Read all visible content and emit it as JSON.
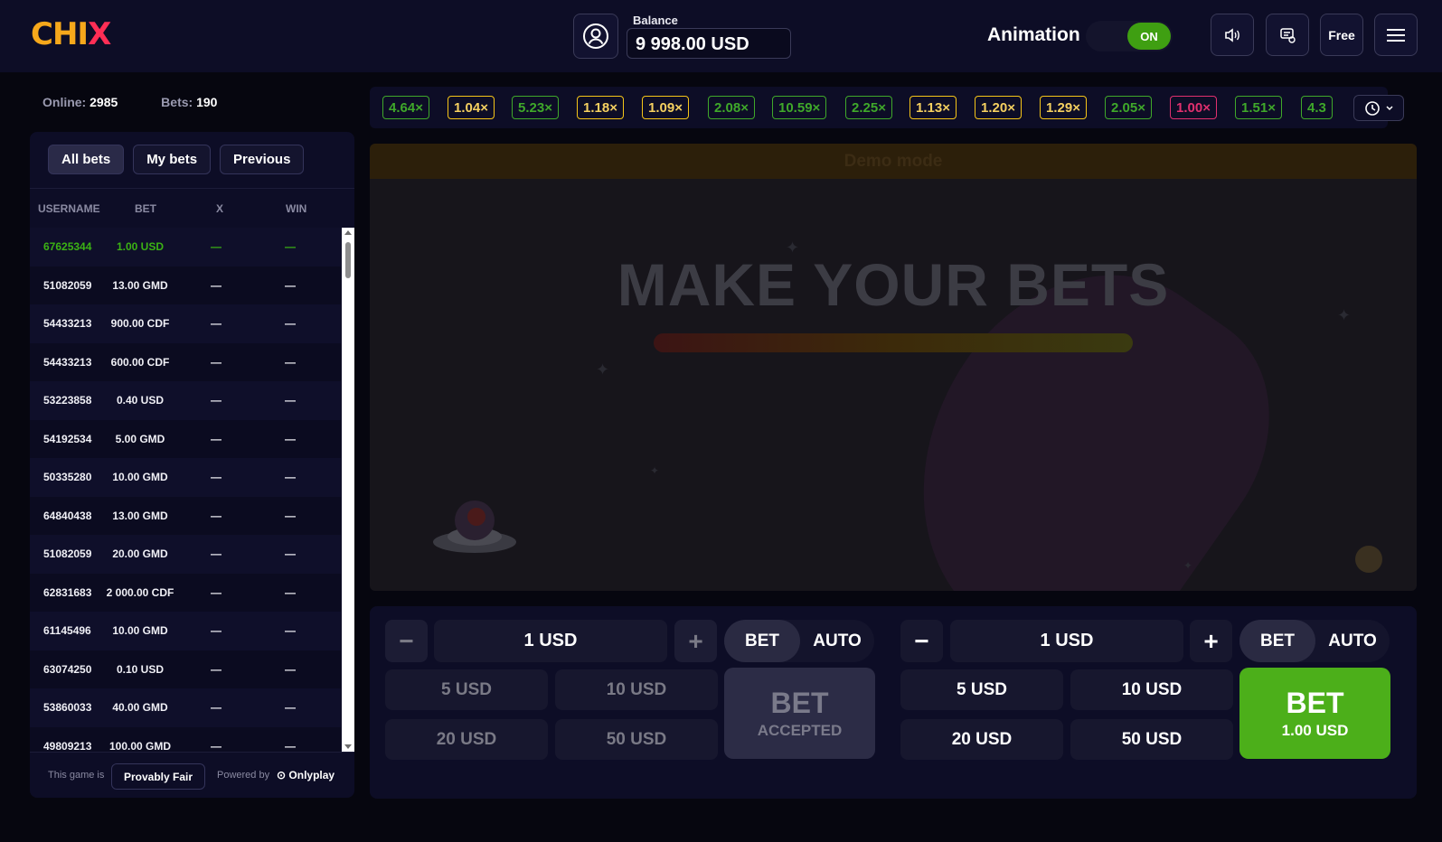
{
  "header": {
    "logo_c": "C",
    "logo_hi": "HI",
    "logo_x": "X",
    "balance_label": "Balance",
    "balance_value": "9 998.00 USD",
    "animation_label": "Animation",
    "animation_state": "ON",
    "free_label": "Free"
  },
  "stats": {
    "online_label": "Online:",
    "online_value": "2985",
    "bets_label": "Bets:",
    "bets_value": "190"
  },
  "bets_panel": {
    "tabs": [
      "All bets",
      "My bets",
      "Previous"
    ],
    "columns": [
      "USERNAME",
      "BET",
      "X",
      "WIN"
    ],
    "rows": [
      {
        "user": "67625344",
        "bet": "1.00 USD",
        "x": "—",
        "win": "—"
      },
      {
        "user": "51082059",
        "bet": "13.00 GMD",
        "x": "—",
        "win": "—"
      },
      {
        "user": "54433213",
        "bet": "900.00 CDF",
        "x": "—",
        "win": "—"
      },
      {
        "user": "54433213",
        "bet": "600.00 CDF",
        "x": "—",
        "win": "—"
      },
      {
        "user": "53223858",
        "bet": "0.40 USD",
        "x": "—",
        "win": "—"
      },
      {
        "user": "54192534",
        "bet": "5.00 GMD",
        "x": "—",
        "win": "—"
      },
      {
        "user": "50335280",
        "bet": "10.00 GMD",
        "x": "—",
        "win": "—"
      },
      {
        "user": "64840438",
        "bet": "13.00 GMD",
        "x": "—",
        "win": "—"
      },
      {
        "user": "51082059",
        "bet": "20.00 GMD",
        "x": "—",
        "win": "—"
      },
      {
        "user": "62831683",
        "bet": "2 000.00 CDF",
        "x": "—",
        "win": "—"
      },
      {
        "user": "61145496",
        "bet": "10.00 GMD",
        "x": "—",
        "win": "—"
      },
      {
        "user": "63074250",
        "bet": "0.10 USD",
        "x": "—",
        "win": "—"
      },
      {
        "user": "53860033",
        "bet": "40.00 GMD",
        "x": "—",
        "win": "—"
      },
      {
        "user": "49809213",
        "bet": "100.00 GMD",
        "x": "—",
        "win": "—"
      }
    ],
    "footer": {
      "game_is": "This game is",
      "provably_fair": "Provably Fair",
      "powered_by": "Powered by",
      "provider": "Onlyplay"
    }
  },
  "multipliers": [
    {
      "v": "4.64×",
      "color": "#3fa82a"
    },
    {
      "v": "1.04×",
      "color": "#f5c518"
    },
    {
      "v": "5.23×",
      "color": "#3fa82a"
    },
    {
      "v": "1.18×",
      "color": "#f5c518"
    },
    {
      "v": "1.09×",
      "color": "#f5c518"
    },
    {
      "v": "2.08×",
      "color": "#3fa82a"
    },
    {
      "v": "10.59×",
      "color": "#3fa82a"
    },
    {
      "v": "2.25×",
      "color": "#3fa82a"
    },
    {
      "v": "1.13×",
      "color": "#f5c518"
    },
    {
      "v": "1.20×",
      "color": "#f5c518"
    },
    {
      "v": "1.29×",
      "color": "#f5c518"
    },
    {
      "v": "2.05×",
      "color": "#3fa82a"
    },
    {
      "v": "1.00×",
      "color": "#e0306e"
    },
    {
      "v": "1.51×",
      "color": "#3fa82a"
    },
    {
      "v": "4.3",
      "color": "#3fa82a"
    }
  ],
  "game": {
    "demo_mode": "Demo mode",
    "message": "MAKE YOUR BETS"
  },
  "bet_panels": [
    {
      "amount": "1 USD",
      "mode_bet": "BET",
      "mode_auto": "AUTO",
      "quick": [
        "5 USD",
        "10 USD",
        "20 USD",
        "50 USD"
      ],
      "button_line1": "BET",
      "button_line2": "ACCEPTED",
      "state": "accepted"
    },
    {
      "amount": "1 USD",
      "mode_bet": "BET",
      "mode_auto": "AUTO",
      "quick": [
        "5 USD",
        "10 USD",
        "20 USD",
        "50 USD"
      ],
      "button_line1": "BET",
      "button_line2": "1.00 USD",
      "state": "active"
    }
  ],
  "colors": {
    "accent_green": "#4caf1a",
    "bg": "#06060f",
    "panel": "#0d0d26"
  }
}
